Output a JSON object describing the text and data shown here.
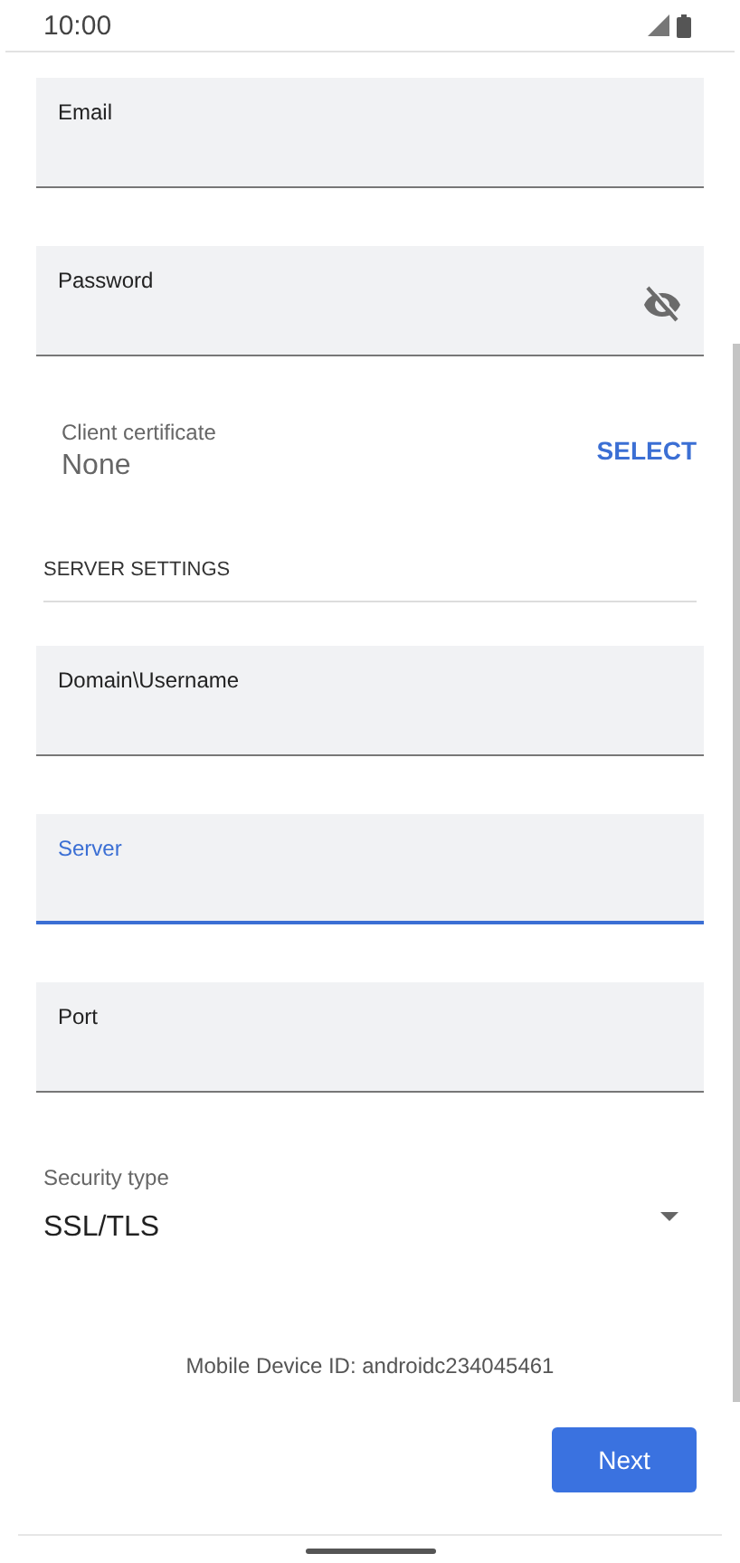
{
  "status_bar": {
    "time": "10:00"
  },
  "account_fields": [
    {
      "label": "Email",
      "kind": "text",
      "focused": false
    },
    {
      "label": "Password",
      "kind": "password",
      "focused": false
    }
  ],
  "client_certificate": {
    "label": "Client certificate",
    "value": "None",
    "action": "SELECT"
  },
  "server_settings": {
    "heading": "SERVER SETTINGS",
    "fields": [
      {
        "label": "Domain\\Username",
        "kind": "text",
        "focused": false
      },
      {
        "label": "Server",
        "kind": "text",
        "focused": true
      },
      {
        "label": "Port",
        "kind": "text",
        "focused": false
      }
    ]
  },
  "security_type": {
    "label": "Security type",
    "value": "SSL/TLS"
  },
  "device_id": "Mobile Device ID: androidc234045461",
  "next_button": "Next"
}
